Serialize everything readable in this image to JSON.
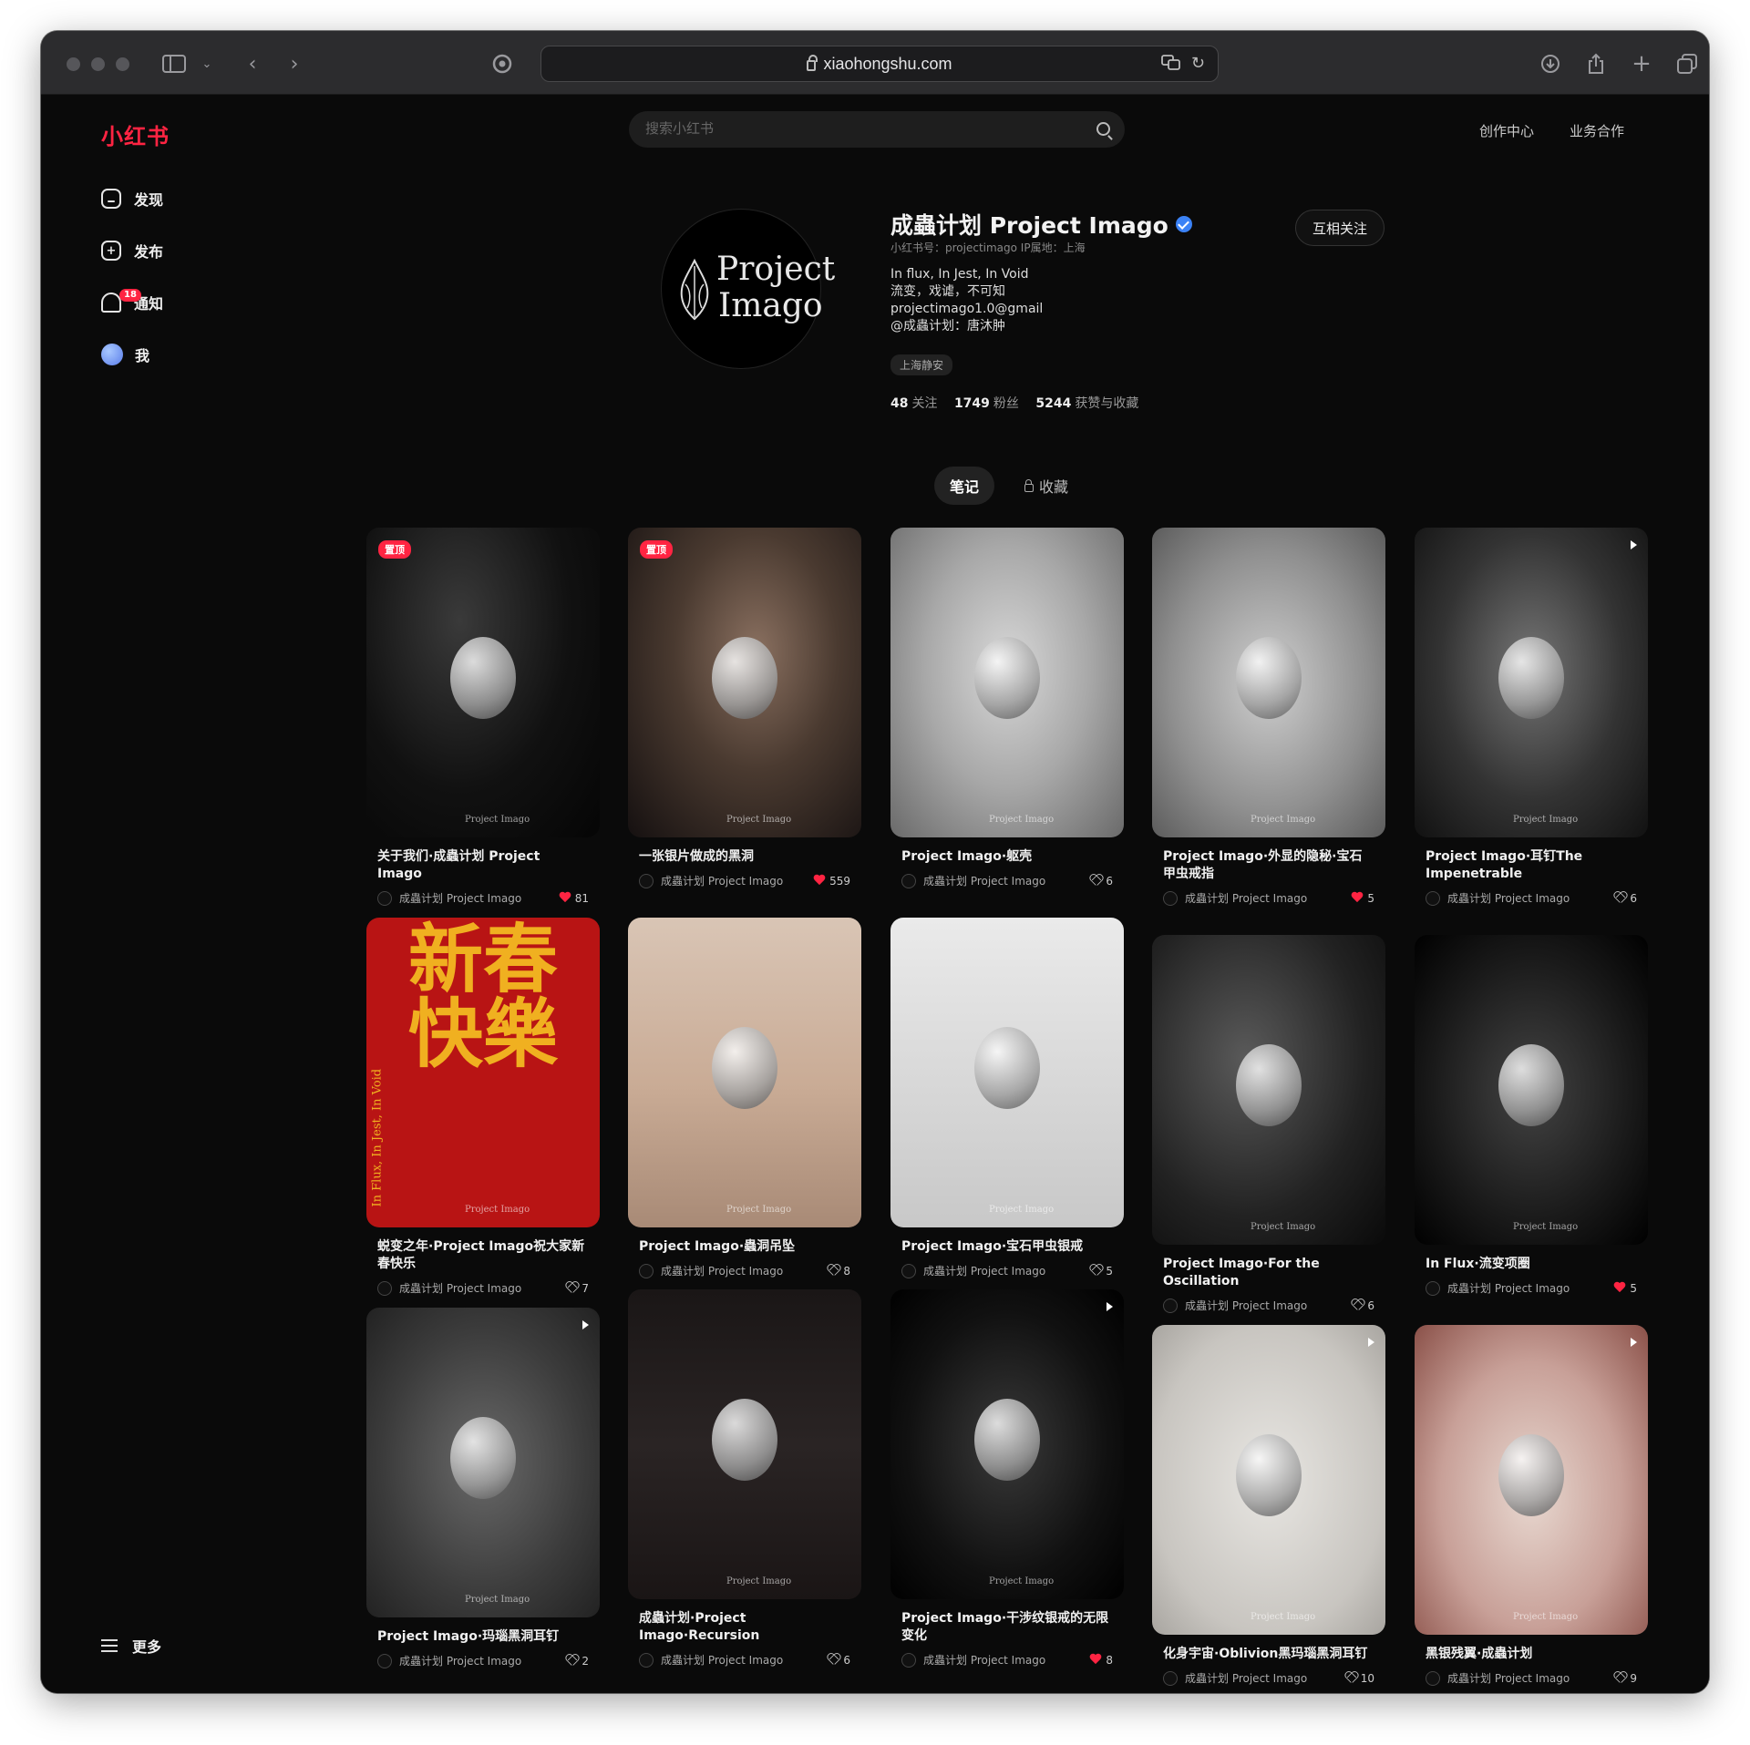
{
  "browser": {
    "url": "xiaohongshu.com"
  },
  "header": {
    "logo": "小红书",
    "search_placeholder": "搜索小红书",
    "links": [
      "创作中心",
      "业务合作"
    ]
  },
  "sidebar": {
    "items": [
      {
        "label": "发现",
        "icon": "home-icon"
      },
      {
        "label": "发布",
        "icon": "plus-icon"
      },
      {
        "label": "通知",
        "icon": "bell-icon",
        "badge": "18"
      },
      {
        "label": "我",
        "icon": "avatar"
      }
    ],
    "more": "更多"
  },
  "profile": {
    "avatar_text_line1": "Project",
    "avatar_text_line2": "Imago",
    "name": "成蟲计划 Project Imago",
    "meta": "小红书号：projectimago  IP属地：上海",
    "bio": [
      "In flux, In Jest, In Void",
      "流变，戏谑，不可知",
      "projectimago1.0@gmail",
      "@成蟲计划：唐沐肿"
    ],
    "tag": "上海静安",
    "stats": {
      "following": "48",
      "following_label": "关注",
      "followers": "1749",
      "followers_label": "粉丝",
      "likes": "5244",
      "likes_label": "获赞与收藏"
    },
    "follow_button": "互相关注"
  },
  "tabs": {
    "notes": "笔记",
    "favorites": "收藏"
  },
  "author": "成蟲计划 Project Imago",
  "pin_label": "置顶",
  "watermark": "Project Imago",
  "notes": [
    {
      "title": "关于我们·成蟲计划 Project Imago",
      "likes": "81",
      "liked": true,
      "pinned": true,
      "video": false,
      "img": "img-dark-portrait"
    },
    {
      "title": "一张银片做成的黑洞",
      "likes": "559",
      "liked": true,
      "pinned": true,
      "video": false,
      "img": "img-ear"
    },
    {
      "title": "Project Imago·躯壳",
      "likes": "6",
      "liked": false,
      "pinned": false,
      "video": false,
      "img": "img-gray-tex"
    },
    {
      "title": "Project Imago·外显的隐秘·宝石甲虫戒指",
      "likes": "5",
      "liked": true,
      "pinned": false,
      "video": false,
      "img": "img-cloth"
    },
    {
      "title": "Project Imago·耳钉The Impenetrable",
      "likes": "6",
      "liked": false,
      "pinned": false,
      "video": true,
      "img": "img-shell"
    },
    {
      "title": "蜕变之年·Project Imago祝大家新春快乐",
      "likes": "7",
      "liked": false,
      "pinned": false,
      "video": false,
      "img": "img-red"
    },
    {
      "title": "Project Imago·蟲洞吊坠",
      "likes": "8",
      "liked": false,
      "pinned": false,
      "video": false,
      "img": "img-neck"
    },
    {
      "title": "Project Imago·宝石甲虫银戒",
      "likes": "5",
      "liked": false,
      "pinned": false,
      "video": false,
      "img": "img-hand"
    },
    {
      "title": "Project Imago·For the Oscillation",
      "likes": "6",
      "liked": false,
      "pinned": false,
      "video": false,
      "img": "img-face"
    },
    {
      "title": "In Flux·流变项圈",
      "likes": "5",
      "liked": true,
      "pinned": false,
      "video": false,
      "img": "img-bw-web"
    },
    {
      "title": "Project Imago·玛瑙黑洞耳钉",
      "likes": "2",
      "liked": false,
      "pinned": false,
      "video": true,
      "img": "img-stone"
    },
    {
      "title": "成蟲计划·Project Imago·Recursion",
      "likes": "6",
      "liked": false,
      "pinned": false,
      "video": false,
      "img": "img-box"
    },
    {
      "title": "Project Imago·干涉纹银戒的无限变化",
      "likes": "8",
      "liked": true,
      "pinned": false,
      "video": true,
      "img": "img-black-ring"
    },
    {
      "title": "化身宇宙·Oblivion黑玛瑙黑洞耳钉",
      "likes": "10",
      "liked": false,
      "pinned": false,
      "video": true,
      "img": "img-linen"
    },
    {
      "title": "黑银残翼·成蟲计划",
      "likes": "9",
      "liked": false,
      "pinned": false,
      "video": true,
      "img": "img-pink"
    }
  ],
  "poster_text": "新春快樂",
  "poster_side_text": "In Flux, In Jest, In Void",
  "colors": {
    "brand": "#ff2442",
    "background": "#0a0a0a",
    "verified": "#3b82f6"
  }
}
